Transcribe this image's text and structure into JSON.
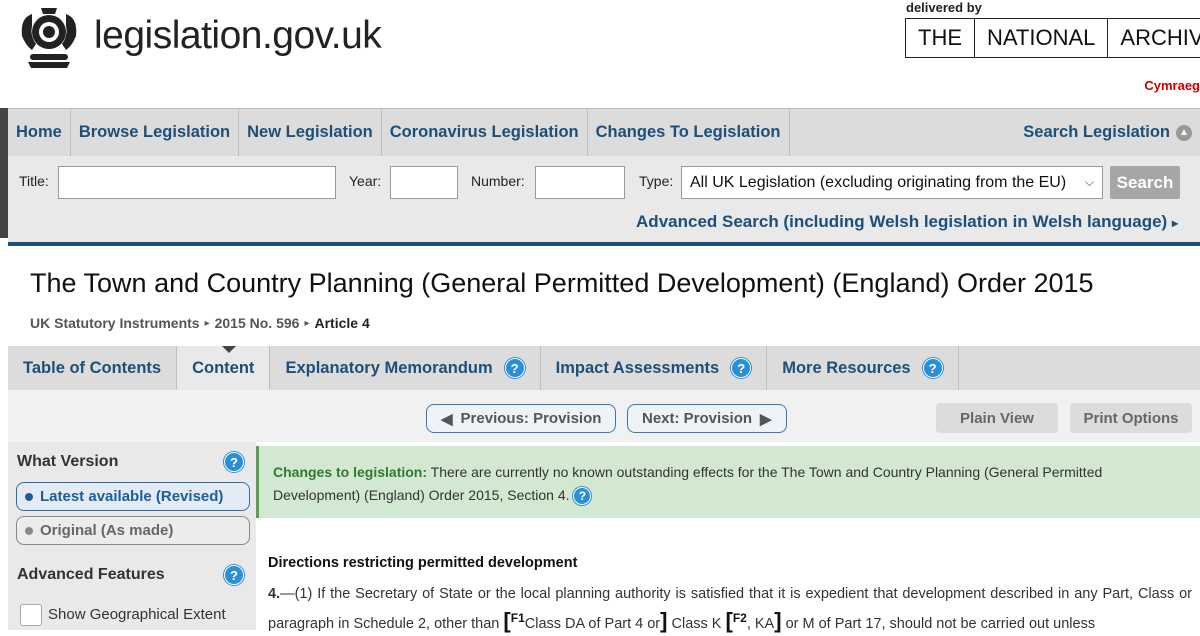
{
  "header": {
    "site_name": "legislation.gov.uk",
    "delivered_by": "delivered by",
    "archives_words": [
      "THE",
      "NATIONAL",
      "ARCHIVES"
    ],
    "cymraeg": "Cymraeg"
  },
  "nav": {
    "items": [
      "Home",
      "Browse Legislation",
      "New Legislation",
      "Coronavirus Legislation",
      "Changes To Legislation"
    ],
    "search_legislation": "Search Legislation"
  },
  "search": {
    "title_label": "Title:",
    "title_value": "",
    "year_label": "Year:",
    "year_value": "",
    "number_label": "Number:",
    "number_value": "",
    "type_label": "Type:",
    "type_selected": "All UK Legislation (excluding originating from the EU)",
    "search_button": "Search",
    "advanced_link": "Advanced Search (including Welsh legislation in Welsh language)"
  },
  "page": {
    "title": "The Town and Country Planning (General Permitted Development) (England) Order 2015",
    "breadcrumb": [
      "UK Statutory Instruments",
      "2015 No. 596",
      "Article 4"
    ]
  },
  "tabs": [
    {
      "label": "Table of Contents",
      "help": false
    },
    {
      "label": "Content",
      "help": false
    },
    {
      "label": "Explanatory Memorandum",
      "help": true
    },
    {
      "label": "Impact Assessments",
      "help": true
    },
    {
      "label": "More Resources",
      "help": true
    }
  ],
  "pager": {
    "previous": "Previous: Provision",
    "next": "Next: Provision",
    "plain_view": "Plain View",
    "print_options": "Print Options"
  },
  "sidebar": {
    "what_version": "What Version",
    "latest": "Latest available (Revised)",
    "original": "Original (As made)",
    "advanced_features": "Advanced Features",
    "show_geo": "Show Geographical Extent"
  },
  "notice": {
    "label": "Changes to legislation:",
    "text": "There are currently no known outstanding effects for the The Town and Country Planning (General Permitted Development) (England) Order 2015, Section 4."
  },
  "content": {
    "section_title": "Directions restricting permitted development",
    "para_num": "4.",
    "para_a": "—(1) If the Secretary of State or the local planning authority is satisfied that it is expedient that development described in any Part, Class or paragraph in Schedule 2, other than ",
    "f1": "F1",
    "para_b": "Class DA of Part 4 or",
    "para_c": " Class K ",
    "f2": "F2",
    "para_d": ", KA",
    "para_e": " or M of Part 17, should not be carried out unless"
  },
  "colors": {
    "link": "#1d4f7b",
    "help": "#2b8fd6",
    "notice_bg": "#d3e8d1",
    "cymraeg": "#cc0000"
  }
}
